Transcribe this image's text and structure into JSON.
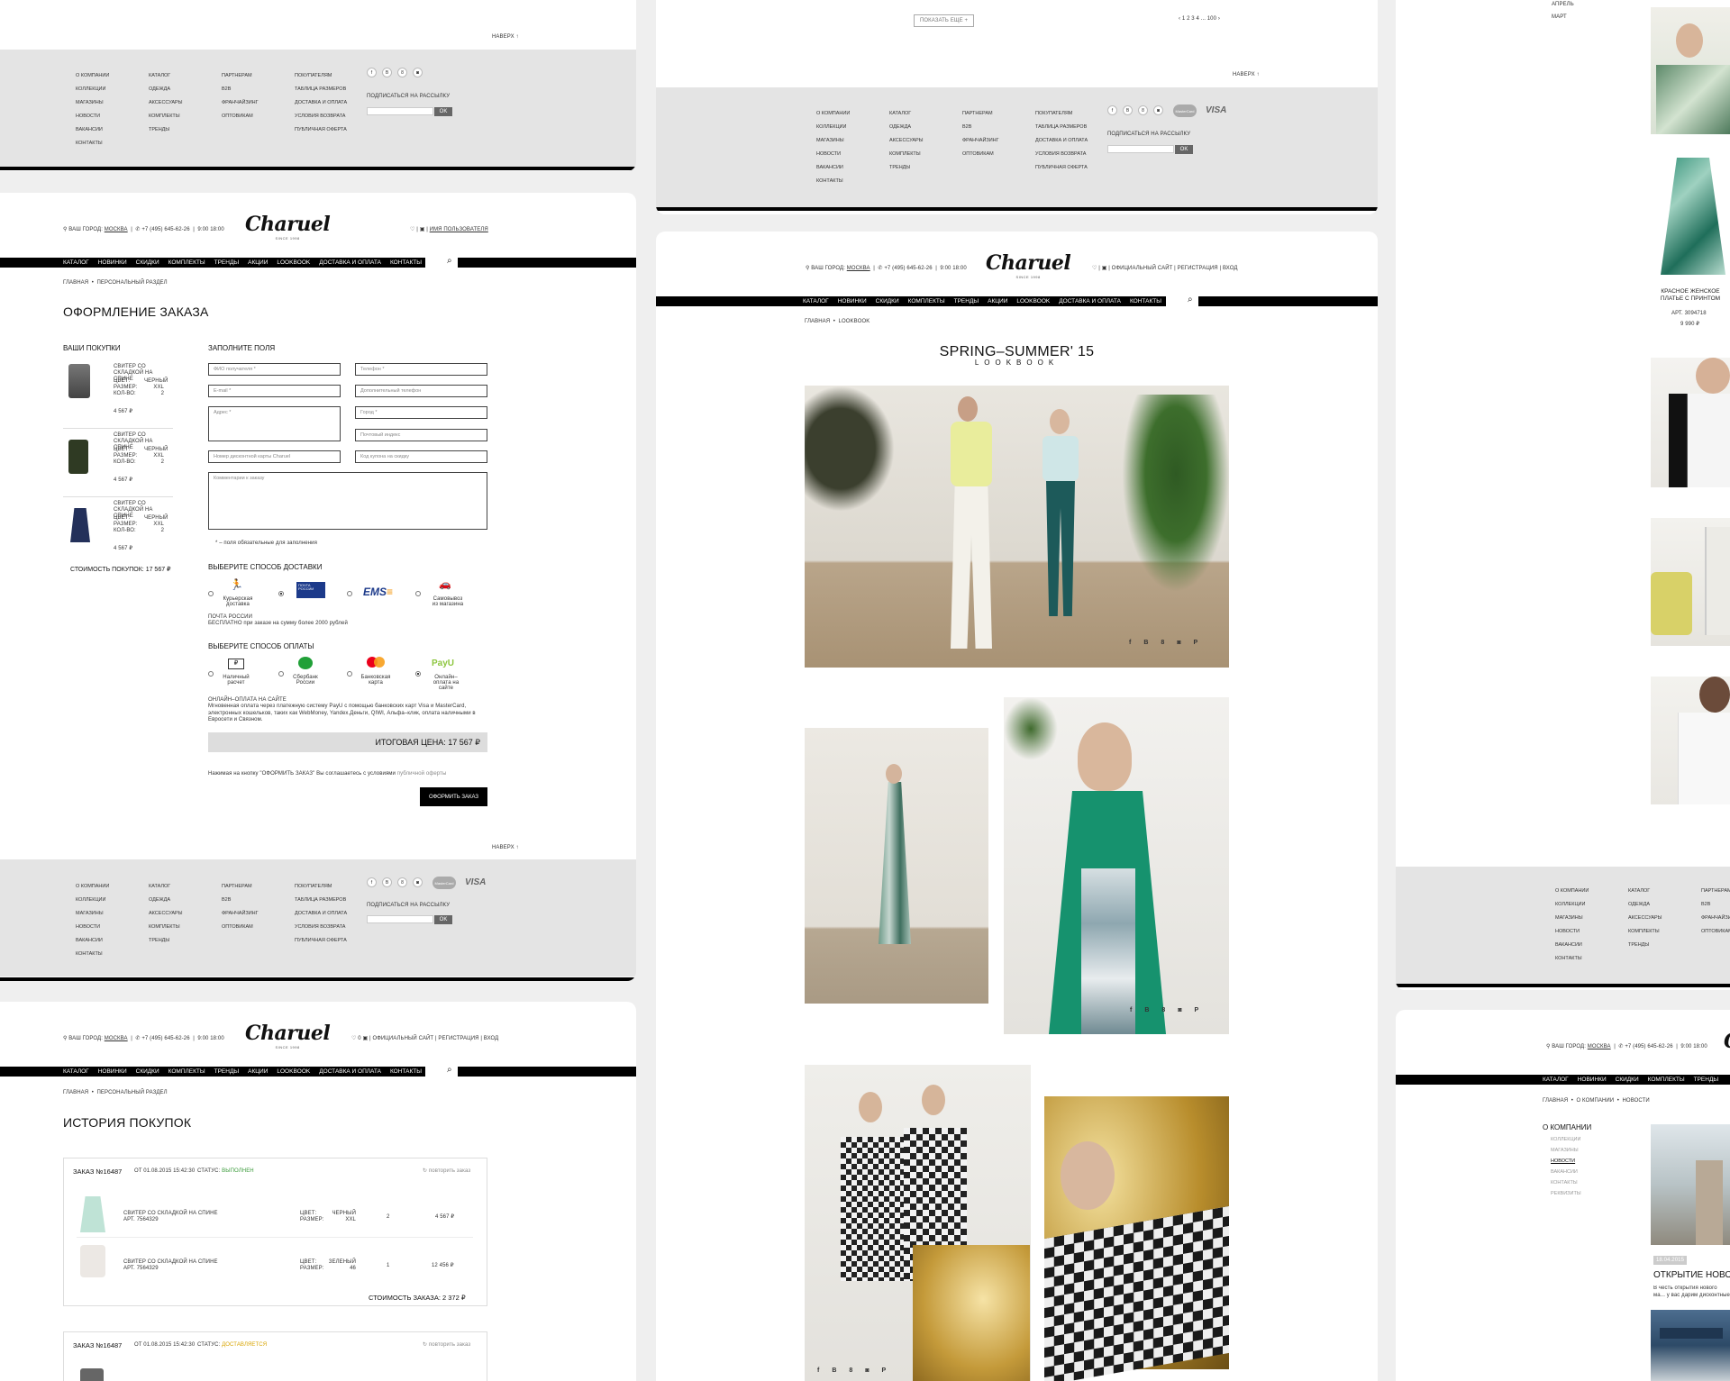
{
  "footer": {
    "col1": [
      "О компании",
      "Коллекции",
      "Магазины",
      "Новости",
      "Вакансии",
      "Контакты"
    ],
    "col2": [
      "Каталог",
      "Одежда",
      "Аксессуары",
      "Комплекты",
      "Тренды"
    ],
    "col3": [
      "Партнерам",
      "B2B",
      "Франчайзинг",
      "Оптовикам"
    ],
    "col4": [
      "Покупателям",
      "Таблица размеров",
      "Доставка и оплата",
      "Условия возврата",
      "Публичная оферта"
    ],
    "social": [
      "f",
      "В",
      "8",
      "◙"
    ],
    "subscribe_label": "ПОДПИСАТЬСЯ НА РАССЫЛКУ",
    "ok": "OK",
    "to_top": "НАВЕРХ",
    "visa": "VISA",
    "mastercard": "MasterCard"
  },
  "header": {
    "city": "ВАШ ГОРОД:",
    "city_value": "МОСКВА",
    "phone": "+7 (495) 645-62-26",
    "hours": "9:00 18:00",
    "logo": "Charuel",
    "logo_sub": "SINCE 1998",
    "username": "ИМЯ ПОЛЬЗОВАТЕЛЯ",
    "official_site": "ОФИЦИАЛЬНЫЙ САЙТ",
    "register": "РЕГИСТРАЦИЯ",
    "login": "ВХОД",
    "cart_count": "0"
  },
  "nav": [
    "Каталог",
    "Новинки",
    "Скидки",
    "Комплекты",
    "Тренды",
    "Акции",
    "Lookbook",
    "Доставка и оплата",
    "Контакты"
  ],
  "checkout": {
    "breadcrumb": [
      "Главная",
      "Персональный раздел"
    ],
    "title": "ОФОРМЛЕНИЕ ЗАКАЗА",
    "your_items": "ВАШИ ПОКУПКИ",
    "items": [
      {
        "name": "СВИТЕР СО СКЛАДКОЙ НА СПИНЕ",
        "color_label": "ЦВЕТ:",
        "color": "ЧЕРНЫЙ",
        "size_label": "РАЗМЕР:",
        "size": "XXL",
        "qty_label": "КОЛ-ВО:",
        "qty": "2",
        "price": "4 567 ₽"
      },
      {
        "name": "СВИТЕР СО СКЛАДКОЙ НА СПИНЕ",
        "color_label": "ЦВЕТ:",
        "color": "ЧЕРНЫЙ",
        "size_label": "РАЗМЕР:",
        "size": "XXL",
        "qty_label": "КОЛ-ВО:",
        "qty": "2",
        "price": "4 567 ₽"
      },
      {
        "name": "СВИТЕР СО СКЛАДКОЙ НА СПИНЕ",
        "color_label": "ЦВЕТ:",
        "color": "ЧЕРНЫЙ",
        "size_label": "РАЗМЕР:",
        "size": "XXL",
        "qty_label": "КОЛ-ВО:",
        "qty": "2",
        "price": "4 567 ₽"
      }
    ],
    "total_items": "СТОИМОСТЬ ПОКУПОК: 17 567 ₽",
    "fill_fields": "ЗАПОЛНИТЕ ПОЛЯ",
    "fields": {
      "fio": "ФИО получателя *",
      "phone": "Телефон *",
      "email": "E-mail *",
      "phone2": "Дополнительный телефон",
      "address": "Адрес *",
      "city": "Город *",
      "index": "Почтовый индекс",
      "card": "Номер дисконтной карты Charuel",
      "coupon": "Код купона на скидку",
      "comment": "Комментарии к заказу"
    },
    "required_note": "* – поля обязательные для заполнения",
    "delivery_title": "ВЫБЕРИТЕ СПОСОБ ДОСТАВКИ",
    "delivery": [
      "Курьерская доставка",
      "ПОЧТА РОССИИ",
      "EMS",
      "Самовывоз из магазина"
    ],
    "delivery_note_title": "ПОЧТА РОССИИ",
    "delivery_note": "БЕСПЛАТНО при заказе на сумму более 2000 рублей",
    "payment_title": "ВЫБЕРИТЕ СПОСОБ ОПЛАТЫ",
    "payment": [
      "Наличный расчет",
      "Сбербанк России",
      "Банковская карта",
      "Онлайн–оплата на сайте"
    ],
    "payment_note_title": "ОНЛАЙН–ОПЛАТА НА САЙТЕ",
    "payment_note": "Мгновенная оплата через платежную систему PayU с помощью банковских карт Visa и MasterCard, электронных кошельков, таких как WebMoney, Yandex.Деньги, QIWI, Альфа–клик, оплата наличными в Евросети и Связном.",
    "final_price": "ИТОГОВАЯ ЦЕНА: 17 567 ₽",
    "agree": "Нажимая на кнопку \"ОФОРМИТЬ ЗАКАЗ\" Вы соглашаетесь с условиями",
    "agree_link": "публичной оферты",
    "submit": "ОФОРМИТЬ ЗАКАЗ"
  },
  "history": {
    "breadcrumb": [
      "Главная",
      "Персональный раздел"
    ],
    "title": "ИСТОРИЯ ПОКУПОК",
    "orders": [
      {
        "number": "ЗАКАЗ №16487",
        "date": "ОТ 01.08.2015 15:42:30",
        "status_label": "СТАТУС:",
        "status": "ВЫПОЛНЕН",
        "repeat": "повторить заказ",
        "rows": [
          {
            "name": "СВИТЕР СО СКЛАДКОЙ НА СПИНЕ",
            "art": "АРТ. 7564329",
            "color_label": "ЦВЕТ:",
            "color": "ЧЕРНЫЙ",
            "size_label": "РАЗМЕР:",
            "size": "XXL",
            "qty": "2",
            "price": "4 567 ₽"
          },
          {
            "name": "СВИТЕР СО СКЛАДКОЙ НА СПИНЕ",
            "art": "АРТ. 7564329",
            "color_label": "ЦВЕТ:",
            "color": "ЗЕЛЕНЫЙ",
            "size_label": "РАЗМЕР:",
            "size": "46",
            "qty": "1",
            "price": "12 456 ₽"
          }
        ],
        "total": "СТОИМОСТЬ ЗАКАЗА: 2 372 ₽"
      },
      {
        "number": "ЗАКАЗ №16487",
        "date": "ОТ 01.08.2015 15:42:30",
        "status_label": "СТАТУС:",
        "status": "ДОСТАВЛЯЕТСЯ",
        "repeat": "повторить заказ"
      }
    ]
  },
  "lookbook": {
    "show_more": "ПОКАЗАТЬ ЕЩЕ",
    "pagination": "‹ 1 2 3 4 ... 100 ›",
    "breadcrumb": [
      "Главная",
      "Lookbook"
    ],
    "title": "SPRING–SUMMER' 15",
    "subtitle": "LOOKBOOK",
    "share": [
      "f",
      "В",
      "8",
      "◙",
      "P"
    ]
  },
  "right": {
    "months": [
      "АПРЕЛЬ",
      "МАРТ"
    ],
    "product_name": "КРАСНОЕ ЖЕНСКОЕ ПЛАТЬЕ С ПРИНТОМ",
    "product_art": "АРТ. 3094718",
    "product_price": "9 990 ₽",
    "breadcrumb": [
      "Главная",
      "О компании",
      "Новости"
    ],
    "side_title": "О КОМПАНИИ",
    "side_menu": [
      "Коллекции",
      "Магазины",
      "Новости",
      "Вакансии",
      "Контакты",
      "Реквизиты"
    ],
    "news_date": "18.04.2015",
    "news_title": "ОТКРЫТИЕ НОВОГО",
    "news_text": "В честь открытия нового ма... у вас дарим дисконтные кар..."
  }
}
